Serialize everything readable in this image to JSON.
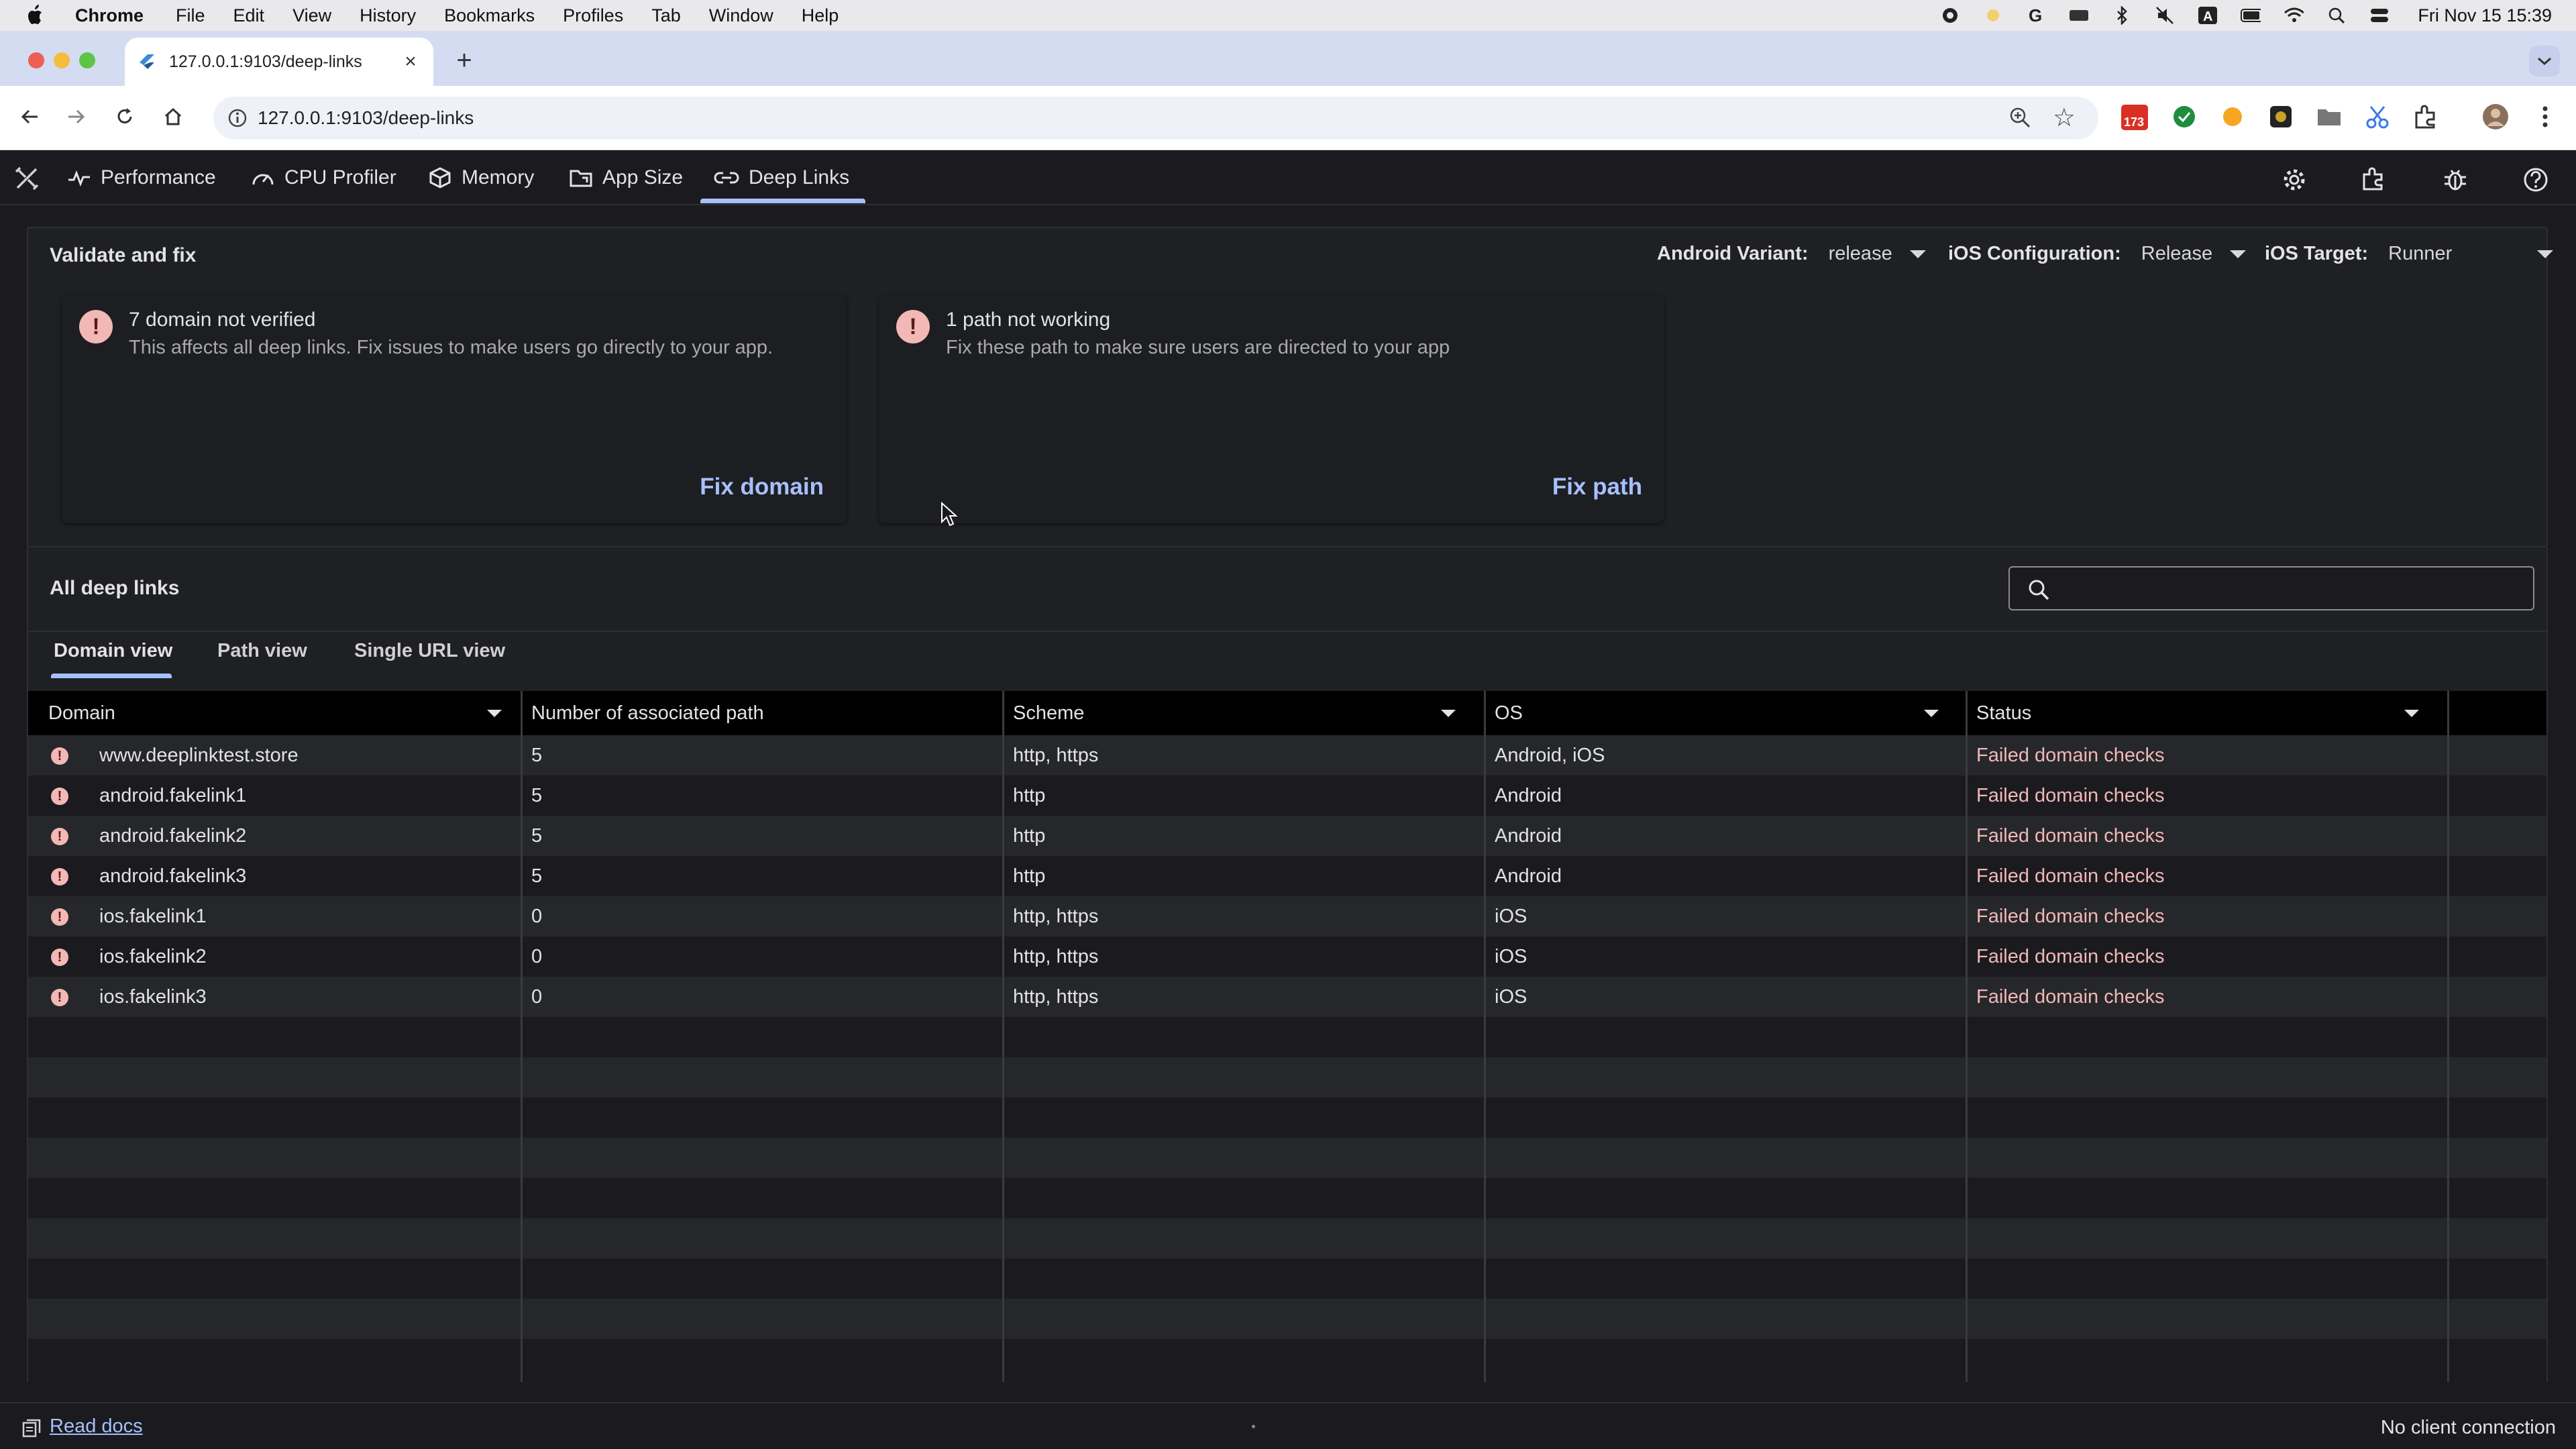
{
  "menubar": {
    "app": "Chrome",
    "items": [
      "File",
      "Edit",
      "View",
      "History",
      "Bookmarks",
      "Profiles",
      "Tab",
      "Window",
      "Help"
    ],
    "clock": "Fri Nov 15  15:39"
  },
  "browser": {
    "tab_title": "127.0.0.1:9103/deep-links",
    "url": "127.0.0.1:9103/deep-links",
    "extension_badge": "173"
  },
  "devtools_nav": {
    "tabs": [
      {
        "label": "Performance",
        "icon": "performance-icon"
      },
      {
        "label": "CPU Profiler",
        "icon": "cpu-profiler-icon"
      },
      {
        "label": "Memory",
        "icon": "memory-icon"
      },
      {
        "label": "App Size",
        "icon": "app-size-icon"
      },
      {
        "label": "Deep Links",
        "icon": "link-icon"
      }
    ],
    "active": "Deep Links"
  },
  "validate": {
    "title": "Validate and fix",
    "android_variant_label": "Android Variant:",
    "android_variant_value": "release",
    "ios_config_label": "iOS Configuration:",
    "ios_config_value": "Release",
    "ios_target_label": "iOS Target:",
    "ios_target_value": "Runner",
    "domain_card": {
      "title": "7 domain not verified",
      "description": "This affects all deep links. Fix issues to make users go directly to your app.",
      "action": "Fix domain"
    },
    "path_card": {
      "title": "1 path not working",
      "description": "Fix these path to make sure users are directed to your app",
      "action": "Fix path"
    }
  },
  "all_links": {
    "title": "All deep links",
    "search_value": "",
    "view_tabs": [
      "Domain view",
      "Path view",
      "Single URL view"
    ],
    "active_view": "Domain view"
  },
  "table": {
    "columns": [
      "Domain",
      "Number of associated path",
      "Scheme",
      "OS",
      "Status"
    ],
    "rows": [
      {
        "domain": "www.deeplinktest.store",
        "paths": "5",
        "scheme": "http, https",
        "os": "Android, iOS",
        "status": "Failed domain checks"
      },
      {
        "domain": "android.fakelink1",
        "paths": "5",
        "scheme": "http",
        "os": "Android",
        "status": "Failed domain checks"
      },
      {
        "domain": "android.fakelink2",
        "paths": "5",
        "scheme": "http",
        "os": "Android",
        "status": "Failed domain checks"
      },
      {
        "domain": "android.fakelink3",
        "paths": "5",
        "scheme": "http",
        "os": "Android",
        "status": "Failed domain checks"
      },
      {
        "domain": "ios.fakelink1",
        "paths": "0",
        "scheme": "http, https",
        "os": "iOS",
        "status": "Failed domain checks"
      },
      {
        "domain": "ios.fakelink2",
        "paths": "0",
        "scheme": "http, https",
        "os": "iOS",
        "status": "Failed domain checks"
      },
      {
        "domain": "ios.fakelink3",
        "paths": "0",
        "scheme": "http, https",
        "os": "iOS",
        "status": "Failed domain checks"
      }
    ]
  },
  "statusbar": {
    "read_docs": "Read docs",
    "connection": "No client connection"
  },
  "colors": {
    "accent": "#a6c0ff",
    "error": "#f2b8b5",
    "background": "#1b1b1f"
  }
}
